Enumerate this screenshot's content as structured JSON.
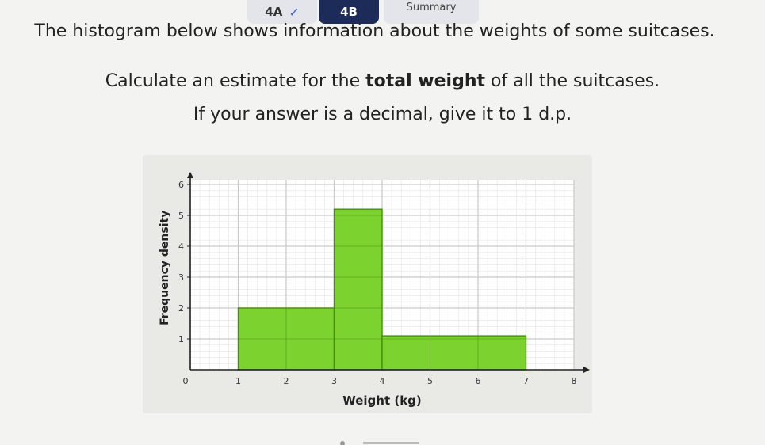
{
  "tabs": [
    {
      "label": "4A",
      "completed": true
    },
    {
      "label": "4B",
      "active": true
    },
    {
      "label": "Summary"
    }
  ],
  "question": {
    "line1": "The histogram below shows information about the weights of some suitcases.",
    "line2_pre": "Calculate an estimate for the ",
    "line2_bold": "total weight",
    "line2_post": " of all the suitcases.",
    "line3": "If your answer is a decimal, give it to 1 d.p."
  },
  "colors": {
    "bar_fill": "#7cd22e",
    "bar_stroke": "#4b8a14",
    "grid": "#c9c9c9",
    "active_tab": "#1d2b59",
    "check": "#3a64c9"
  },
  "chart_data": {
    "type": "bar",
    "xlabel": "Weight (kg)",
    "ylabel": "Frequency density",
    "xlim": [
      0,
      8
    ],
    "ylim": [
      0,
      6
    ],
    "xticks": [
      0,
      1,
      2,
      3,
      4,
      5,
      6,
      7,
      8
    ],
    "yticks": [
      1,
      2,
      3,
      4,
      5,
      6
    ],
    "bars": [
      {
        "x0": 1,
        "x1": 3,
        "value": 2
      },
      {
        "x0": 3,
        "x1": 4,
        "value": 5.2
      },
      {
        "x0": 4,
        "x1": 7,
        "value": 1.1
      }
    ],
    "grid": true
  }
}
